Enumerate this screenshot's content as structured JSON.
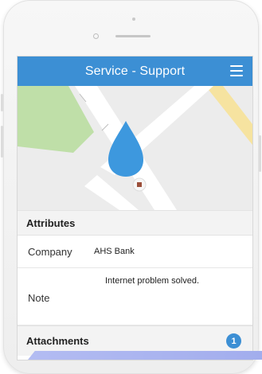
{
  "header": {
    "title": "Service - Support"
  },
  "icons": {
    "menu": "hamburger-menu-icon",
    "location": "location-drop-pin-icon",
    "marker": "map-marker-square-icon"
  },
  "colors": {
    "app_bar": "#3c8fd4",
    "pin": "#3d98de",
    "park": "#bfdfa8",
    "highway": "#f6e3a0",
    "badge": "#3c8fd4"
  },
  "attributes": {
    "header": "Attributes",
    "company": {
      "label": "Company",
      "value": "AHS Bank"
    },
    "note": {
      "label": "Note",
      "value": "Internet problem solved."
    }
  },
  "attachments": {
    "header": "Attachments",
    "count": "1"
  }
}
